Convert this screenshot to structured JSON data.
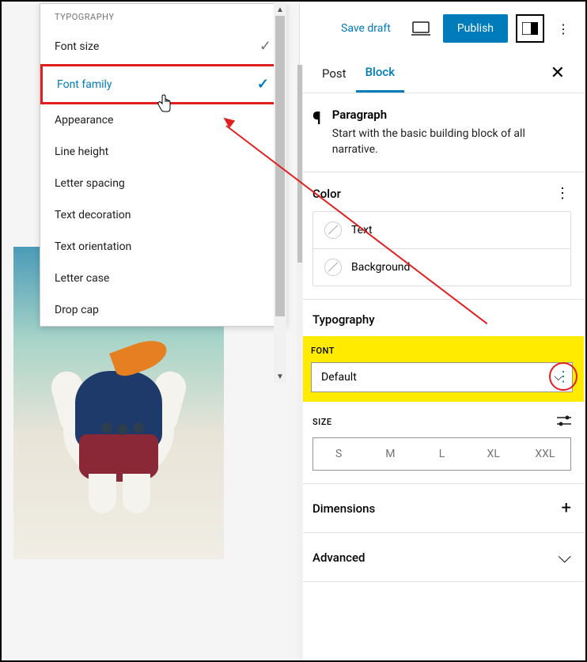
{
  "dropdown": {
    "header": "TYPOGRAPHY",
    "items": [
      {
        "label": "Font size",
        "checked": "gray"
      },
      {
        "label": "Font family",
        "checked": "blue",
        "highlighted": true
      },
      {
        "label": "Appearance",
        "checked": null
      },
      {
        "label": "Line height",
        "checked": null
      },
      {
        "label": "Letter spacing",
        "checked": null
      },
      {
        "label": "Text decoration",
        "checked": null
      },
      {
        "label": "Text orientation",
        "checked": null
      },
      {
        "label": "Letter case",
        "checked": null
      },
      {
        "label": "Drop cap",
        "checked": null
      }
    ]
  },
  "topbar": {
    "save_draft": "Save draft",
    "publish": "Publish"
  },
  "tabs": {
    "post": "Post",
    "block": "Block"
  },
  "block_info": {
    "title": "Paragraph",
    "description": "Start with the basic building block of all narrative."
  },
  "color_section": {
    "title": "Color",
    "text_label": "Text",
    "background_label": "Background"
  },
  "typography_section": {
    "title": "Typography",
    "font_label": "FONT",
    "font_value": "Default",
    "size_label": "SIZE",
    "sizes": [
      "S",
      "M",
      "L",
      "XL",
      "XXL"
    ]
  },
  "dimensions_section": {
    "title": "Dimensions"
  },
  "advanced_section": {
    "title": "Advanced"
  }
}
